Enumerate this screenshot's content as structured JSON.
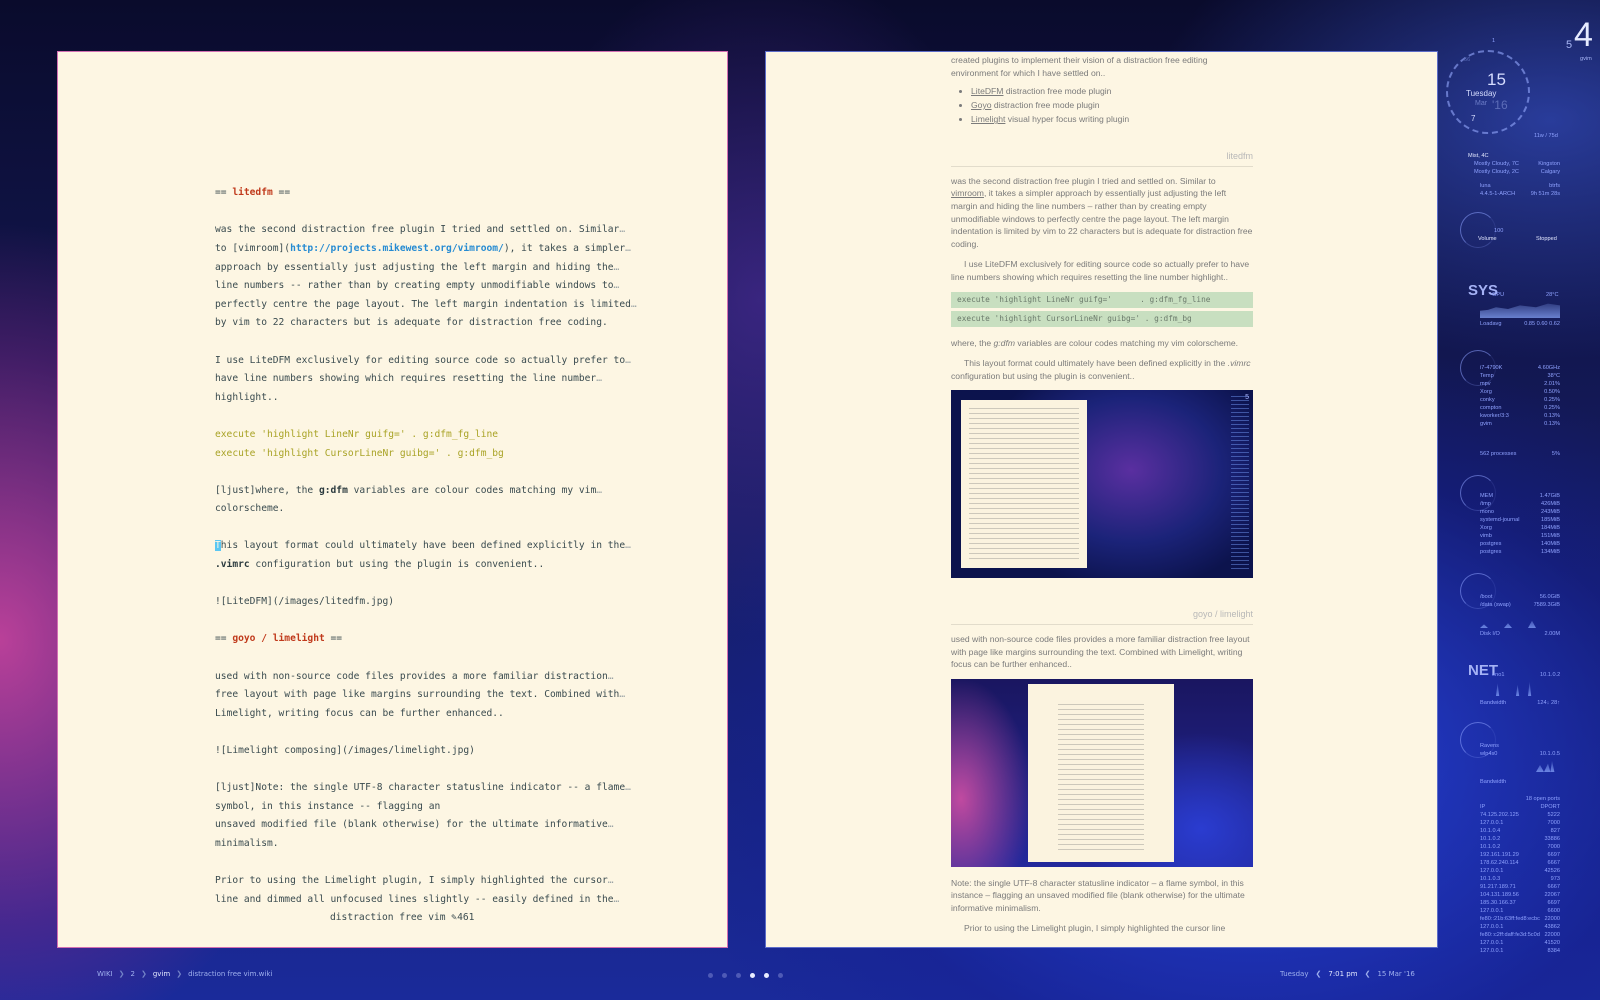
{
  "vim": {
    "lines": [
      {
        "text": ""
      },
      {
        "text": ""
      },
      {
        "segments": [
          {
            "t": "== "
          },
          {
            "t": "litedfm",
            "c": "hl-red"
          },
          {
            "t": " =="
          }
        ]
      },
      {
        "text": ""
      },
      {
        "text": "was the second distraction free plugin I tried and settled on. Similar",
        "wrap": true
      },
      {
        "segments": [
          {
            "t": "to [vimroom]("
          },
          {
            "t": "http://projects.mikewest.org/vimroom/",
            "c": "hl-blue"
          },
          {
            "t": "), it takes a simpler"
          }
        ],
        "wrap": true
      },
      {
        "text": "approach by essentially just adjusting the left margin and hiding the",
        "wrap": true
      },
      {
        "text": "line numbers -- rather than by creating empty unmodifiable windows to",
        "wrap": true
      },
      {
        "text": "perfectly centre the page layout. The left margin indentation is limited",
        "wrap": true
      },
      {
        "text": "by vim to 22 characters but is adequate for distraction free coding."
      },
      {
        "text": ""
      },
      {
        "text": "I use LiteDFM exclusively for editing source code so actually prefer to",
        "wrap": true
      },
      {
        "text": "have line numbers showing which requires resetting the line number",
        "wrap": true
      },
      {
        "text": "highlight.."
      },
      {
        "text": ""
      },
      {
        "segments": [
          {
            "t": "execute 'highlight LineNr guifg='      . g:dfm_fg_line",
            "c": "hl-olive"
          }
        ]
      },
      {
        "segments": [
          {
            "t": "execute 'highlight CursorLineNr guibg=' . g:dfm_bg",
            "c": "hl-olive"
          }
        ]
      },
      {
        "text": ""
      },
      {
        "segments": [
          {
            "t": "[ljust]where, the "
          },
          {
            "t": "g:dfm",
            "c": "hl-bold"
          },
          {
            "t": " variables are colour codes matching my vim"
          }
        ],
        "wrap": true
      },
      {
        "text": "colorscheme."
      },
      {
        "text": ""
      },
      {
        "segments": [
          {
            "t": "T",
            "c": "cursor"
          },
          {
            "t": "his layout format could ultimately have been defined explicitly in the"
          }
        ],
        "wrap": true
      },
      {
        "segments": [
          {
            "t": ".vimrc",
            "c": "hl-bold"
          },
          {
            "t": " configuration but using the plugin is convenient.."
          }
        ]
      },
      {
        "text": ""
      },
      {
        "text": "![LiteDFM](/images/litedfm.jpg)"
      },
      {
        "text": ""
      },
      {
        "segments": [
          {
            "t": "== "
          },
          {
            "t": "goyo / limelight",
            "c": "hl-red"
          },
          {
            "t": " =="
          }
        ]
      },
      {
        "text": ""
      },
      {
        "text": "used with non-source code files provides a more familiar distraction",
        "wrap": true
      },
      {
        "text": "free layout with page like margins surrounding the text. Combined with",
        "wrap": true
      },
      {
        "text": "Limelight, writing focus can be further enhanced.."
      },
      {
        "text": ""
      },
      {
        "text": "![Limelight composing](/images/limelight.jpg)"
      },
      {
        "text": ""
      },
      {
        "text": "[ljust]Note: the single UTF-8 character statusline indicator -- a flame",
        "wrap": true
      },
      {
        "text": "symbol, in this instance -- flagging an"
      },
      {
        "text": "unsaved modified file (blank otherwise) for the ultimate informative",
        "wrap": true
      },
      {
        "text": "minimalism."
      },
      {
        "text": ""
      },
      {
        "text": "Prior to using the Limelight plugin, I simply highlighted the cursor",
        "wrap": true
      },
      {
        "text": "line and dimmed all unfocused lines slightly -- easily defined in the",
        "wrap": true
      }
    ],
    "wrap_marker": "…",
    "statusline": "distraction free vim ✎461"
  },
  "web": {
    "intro": "created plugins to implement their vision of a distraction free editing environment for which I have settled on..",
    "plugins": [
      {
        "name": "LiteDFM",
        "rest": " distraction free mode plugin"
      },
      {
        "name": "Goyo",
        "rest": " distraction free mode plugin"
      },
      {
        "name": "Limelight",
        "rest": " visual hyper focus writing plugin"
      }
    ],
    "section1_title": "litedfm",
    "s1_p1_a": "was the second distraction free plugin I tried and settled on. Similar to ",
    "s1_p1_link": "vimroom",
    "s1_p1_b": ", it takes a simpler approach by essentially just adjusting the left margin and hiding the line numbers – rather than by creating empty unmodifiable windows to perfectly centre the page layout. The left margin indentation is limited by vim to 22 characters but is adequate for distraction free coding.",
    "s1_p2": "I use LiteDFM exclusively for editing source code so actually prefer to have line numbers showing which requires resetting the line number highlight..",
    "code1": "execute 'highlight LineNr guifg='      . g:dfm_fg_line",
    "code2": "execute 'highlight CursorLineNr guibg=' . g:dfm_bg",
    "s1_p3_a": "where, the ",
    "s1_p3_em": "g:dfm",
    "s1_p3_b": " variables are colour codes matching my vim colorscheme.",
    "s1_p4_a": "This layout format could ultimately have been defined explicitly in the ",
    "s1_p4_em": ".vimrc",
    "s1_p4_b": " configuration but using the plugin is convenient..",
    "shot1_num": "5",
    "section2_title": "goyo / limelight",
    "s2_p1": "used with non-source code files provides a more familiar distraction free layout with page like margins surrounding the text. Combined with Limelight, writing focus can be further enhanced..",
    "s2_p2": "Note: the single UTF-8 character statusline indicator – a flame symbol, in this instance – flagging an unsaved modified file (blank otherwise) for the ultimate informative minimalism.",
    "s2_p3": "Prior to using the Limelight plugin, I simply highlighted the cursor line"
  },
  "conky": {
    "desktop_num": "4",
    "desktop_small": "5",
    "desktop_app": "gvim",
    "clock": {
      "day_num": "15",
      "weekday": "Tuesday",
      "month": "Mar",
      "year": "'16",
      "hour": "7",
      "min_top": "1",
      "min_label": "56"
    },
    "weather_range": "11w / 75d",
    "weather": {
      "title": "Mist, 4C",
      "l1": "Mostly Cloudy, 7C",
      "r1": "Kingston",
      "l2": "Mostly Cloudy, 2C",
      "r2": "Calgary"
    },
    "system": {
      "os": "luna",
      "fs": "btrfs",
      "kernel": "4.4.5-1-ARCH",
      "uptime": "9h 51m 28s"
    },
    "volume_label": "Volume",
    "volume_state": "Stopped",
    "volume_max": "100",
    "sys_head": "SYS",
    "sys_gpu": "GPU",
    "sys_temp": "28°C",
    "loadavg_label": "Loadavg",
    "loadavg": "0.85  0.60  0.62",
    "cpu": {
      "name": "i7-4790K",
      "freq": "4.60GHz",
      "temp_label": "Temp",
      "temp": "38°C"
    },
    "procs": [
      {
        "n": "mpv",
        "v": "2.01%"
      },
      {
        "n": "Xorg",
        "v": "0.50%"
      },
      {
        "n": "conky",
        "v": "0.25%"
      },
      {
        "n": "compton",
        "v": "0.25%"
      },
      {
        "n": "kworker/3:3",
        "v": "0.13%"
      },
      {
        "n": "gvim",
        "v": "0.13%"
      }
    ],
    "processes": "562 processes",
    "processes_pct": "5%",
    "mem_label": "MEM",
    "mem_total": "1.47GiB",
    "mem": [
      {
        "n": "/tmp",
        "v": "426MiB"
      },
      {
        "n": "mono",
        "v": "243MiB"
      },
      {
        "n": "systemd-journal",
        "v": "185MiB"
      },
      {
        "n": "Xorg",
        "v": "184MiB"
      },
      {
        "n": "vimb",
        "v": "151MiB"
      },
      {
        "n": "postgres",
        "v": "140MiB"
      },
      {
        "n": "postgres",
        "v": "134MiB"
      }
    ],
    "disk": [
      {
        "n": "/boot",
        "v": "56.0GiB"
      },
      {
        "n": "/data  (swap)",
        "v": "7589.3GiB"
      }
    ],
    "diskio_label": "Disk I/O",
    "diskio": "2.00M",
    "net_head": "NET",
    "net_if": "eno1",
    "net_ip": "10.1.0.2",
    "bandwidth_label": "Bandwidth",
    "bandwidth": "124↓  28↑",
    "wifi": {
      "name": "Ravens",
      "iface": "wlp4s0",
      "ip": "10.1.0.5",
      "bandwidth_label": "Bandwidth"
    },
    "ports_head": "18 open ports",
    "ports_cols": [
      "IP",
      "DPORT"
    ],
    "ports": [
      [
        "74.125.202.125",
        "5222"
      ],
      [
        "127.0.0.1",
        "7000"
      ],
      [
        "10.1.0.4",
        "827"
      ],
      [
        "10.1.0.2",
        "33886"
      ],
      [
        "10.1.0.2",
        "7000"
      ],
      [
        "192.161.191.29",
        "6697"
      ],
      [
        "178.62.240.114",
        "6667"
      ],
      [
        "127.0.0.1",
        "42526"
      ],
      [
        "10.1.0.3",
        "973"
      ],
      [
        "91.217.189.71",
        "6667"
      ],
      [
        "104.131.189.56",
        "22067"
      ],
      [
        "185.30.166.37",
        "6697"
      ],
      [
        "127.0.0.1",
        "6600"
      ],
      [
        "fe80::21b:63ff:fed8:ecbc",
        "22000"
      ],
      [
        "127.0.0.1",
        "43862"
      ],
      [
        "fe80::c2ff:daff:fe3d:5c0d",
        "22000"
      ],
      [
        "127.0.0.1",
        "41520"
      ],
      [
        "127.0.0.1",
        "8384"
      ]
    ]
  },
  "bottom": {
    "crumbs": [
      "WIKI",
      "2",
      "gvim",
      "distraction free vim.wiki"
    ],
    "dots": [
      false,
      false,
      false,
      true,
      true,
      false
    ],
    "weekday": "Tuesday",
    "time": "7:01 pm",
    "date": "15 Mar '16"
  }
}
